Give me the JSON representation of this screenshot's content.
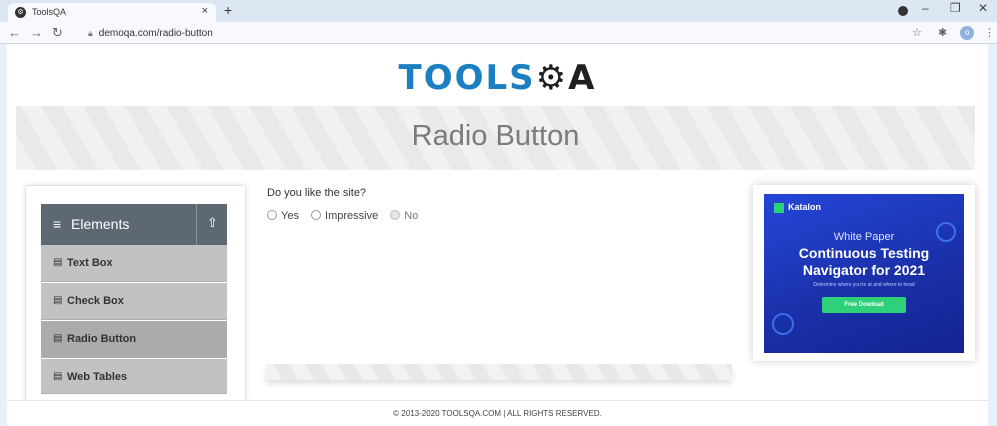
{
  "browser": {
    "tab_title": "ToolsQA",
    "tab_close": "×",
    "new_tab": "+",
    "url": "demoqa.com/radio-button",
    "profile_initial": "o"
  },
  "site": {
    "logo_tools": "TOOLS",
    "logo_qa": "A",
    "page_title": "Radio Button"
  },
  "sidebar": {
    "group_label": "Elements",
    "items": [
      {
        "label": "Text Box",
        "active": false
      },
      {
        "label": "Check Box",
        "active": false
      },
      {
        "label": "Radio Button",
        "active": true
      },
      {
        "label": "Web Tables",
        "active": false
      }
    ]
  },
  "main": {
    "question": "Do you like the site?",
    "options": [
      {
        "label": "Yes",
        "disabled": false
      },
      {
        "label": "Impressive",
        "disabled": false
      },
      {
        "label": "No",
        "disabled": true
      }
    ]
  },
  "ad": {
    "brand": "Katalon",
    "kicker": "White Paper",
    "headline_line1": "Continuous Testing",
    "headline_line2": "Navigator for 2021",
    "subtext": "Determine where you're at and where to head",
    "cta": "Free Dowload"
  },
  "footer": {
    "text": "© 2013-2020 TOOLSQA.COM | ALL RIGHTS RESERVED."
  },
  "colors": {
    "logo_blue": "#1b7fc2",
    "sidebar_header": "#5d6872",
    "menu_item": "#c2c2c2",
    "menu_item_active": "#ababab",
    "ad_background": "#2446d8",
    "ad_cta": "#2fd07a"
  }
}
